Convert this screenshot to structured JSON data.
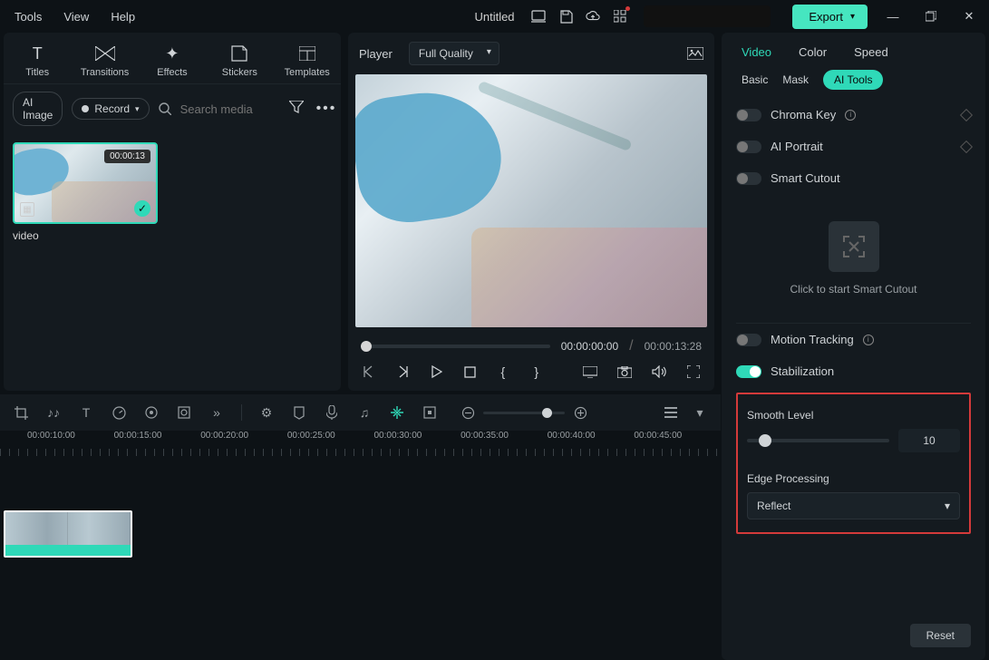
{
  "menu": {
    "tools": "Tools",
    "view": "View",
    "help": "Help"
  },
  "title": "Untitled",
  "export": "Export",
  "tool_tabs": {
    "titles": "Titles",
    "transitions": "Transitions",
    "effects": "Effects",
    "stickers": "Stickers",
    "templates": "Templates"
  },
  "left": {
    "ai_image": "AI Image",
    "record": "Record",
    "search_ph": "Search media"
  },
  "clip": {
    "duration": "00:00:13",
    "name": "video"
  },
  "player": {
    "label": "Player",
    "quality": "Full Quality",
    "current": "00:00:00:00",
    "total": "00:00:13:28"
  },
  "rp_tabs": {
    "video": "Video",
    "color": "Color",
    "speed": "Speed"
  },
  "rp_sub": {
    "basic": "Basic",
    "mask": "Mask",
    "ai": "AI Tools"
  },
  "toggles": {
    "chroma": "Chroma Key",
    "portrait": "AI Portrait",
    "cutout": "Smart Cutout",
    "tracking": "Motion Tracking",
    "stab": "Stabilization"
  },
  "smart_hint": "Click to start Smart Cutout",
  "smooth": {
    "label": "Smooth Level",
    "value": "10"
  },
  "edge": {
    "label": "Edge Processing",
    "value": "Reflect"
  },
  "reset": "Reset",
  "ruler": [
    "00:00:10:00",
    "00:00:15:00",
    "00:00:20:00",
    "00:00:25:00",
    "00:00:30:00",
    "00:00:35:00",
    "00:00:40:00",
    "00:00:45:00"
  ]
}
